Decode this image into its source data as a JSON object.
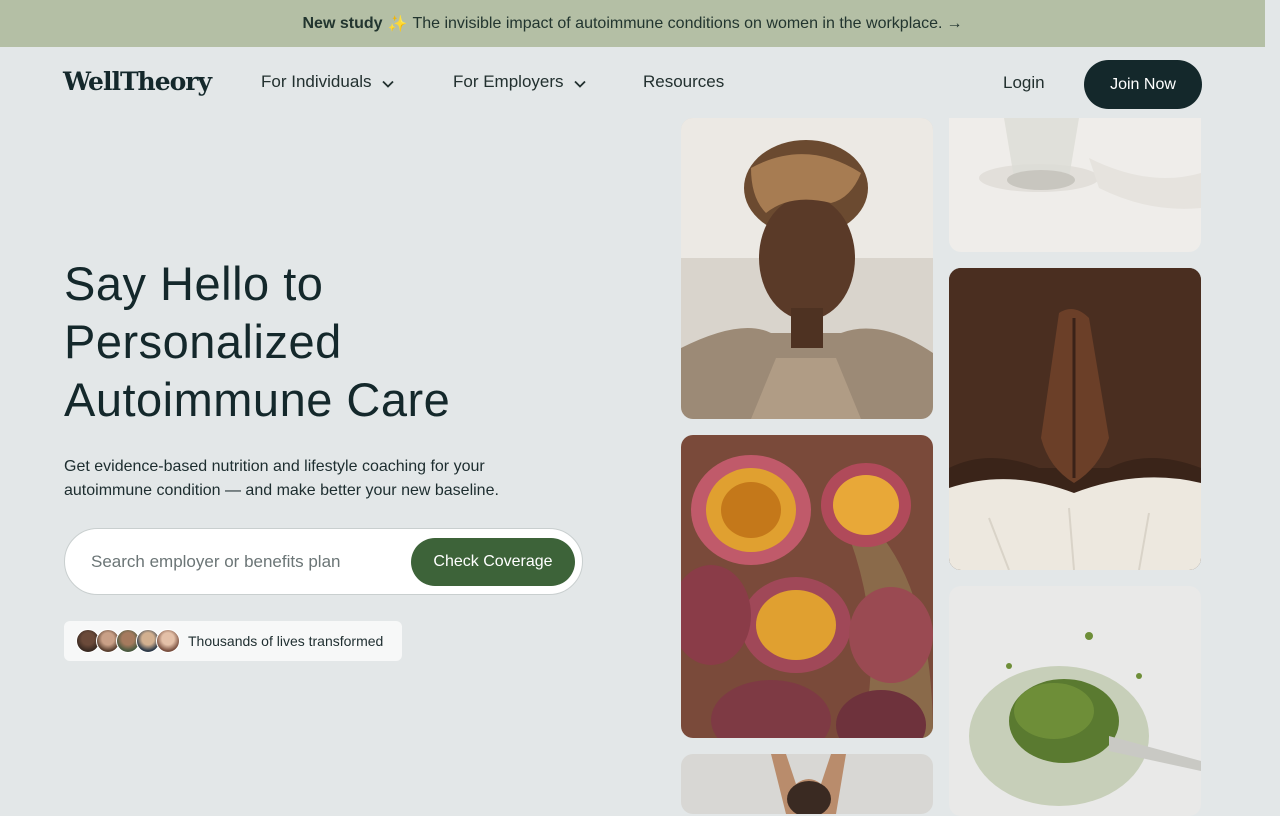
{
  "banner": {
    "strong": "New study",
    "sparkle": "✨",
    "text": "The invisible impact of autoimmune conditions on women in the workplace.",
    "arrow": "→"
  },
  "header": {
    "logo": "WellTheory",
    "nav": [
      {
        "label": "For Individuals",
        "icon": "chevron-down-icon"
      },
      {
        "label": "For Employers",
        "icon": "chevron-down-icon"
      },
      {
        "label": "Resources"
      }
    ],
    "login": "Login",
    "join": "Join Now"
  },
  "hero": {
    "title_lines": [
      "Say Hello to",
      "Personalized",
      "Autoimmune Care"
    ],
    "subtitle": "Get evidence-based nutrition and lifestyle coaching for your autoimmune condition — and make better your new baseline.",
    "search": {
      "placeholder": "Search employer or benefits plan",
      "value": ""
    },
    "cta": "Check Coverage",
    "social_proof": "Thousands of lives transformed"
  },
  "photos": [
    {
      "name": "woman-portrait-photo"
    },
    {
      "name": "glass-of-water-photo"
    },
    {
      "name": "hands-on-back-photo"
    },
    {
      "name": "passion-fruit-basket-photo"
    },
    {
      "name": "matcha-powder-spoon-photo"
    },
    {
      "name": "person-stretching-photo"
    }
  ],
  "colors": {
    "banner_bg": "#b4bfa5",
    "page_bg": "#e3e7e8",
    "dark_accent": "#14282b",
    "cta_green": "#3d6339"
  }
}
